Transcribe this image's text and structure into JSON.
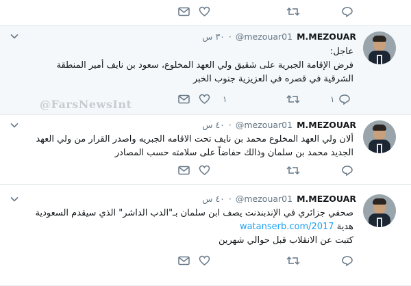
{
  "colors": {
    "accent": "#1da1f2",
    "muted": "#657786",
    "text": "#14171a",
    "highlight_bg": "#f5f8fa",
    "divider": "#e6ecf0"
  },
  "watermark": "@FarsNewsInt",
  "top_actions": {
    "reply_icon": "reply-icon",
    "retweet_icon": "retweet-icon",
    "like_icon": "heart-icon",
    "dm_icon": "envelope-icon"
  },
  "tweets": [
    {
      "name": "M.MEZOUAR",
      "handle": "@mezouar01",
      "time": "٣٠ س",
      "lines": [
        "عاجل:",
        "فرض الإقامة الجبرية على شقيق ولي العهد المخلوع، سعود بن نايف أمير المنطقة",
        "الشرقية في قصره في العزيزية جنوب الخبر"
      ],
      "reply_count": "١",
      "like_count": "١"
    },
    {
      "name": "M.MEZOUAR",
      "handle": "@mezouar01",
      "time": "٤٠ س",
      "lines": [
        "ألان ولي العهد المخلوع محمد بن نايف تحت الاقامه الجبريه واصدر القرار من ولي العهد",
        "الجديد محمد بن سلمان وذالك حفاضاً على سلامته حسب المصادر"
      ]
    },
    {
      "name": "M.MEZOUAR",
      "handle": "@mezouar01",
      "time": "٤٠ س",
      "lines": [
        "صحفي جزائري في الإندبندنت يصف ابن سلمان بـ\"الدب الداشر\" الذي سيقدم السعودية",
        "هدية",
        "كتبت عن الانقلاب قبل حوالي شهرين"
      ],
      "link": "watanserb.com/2017"
    }
  ]
}
